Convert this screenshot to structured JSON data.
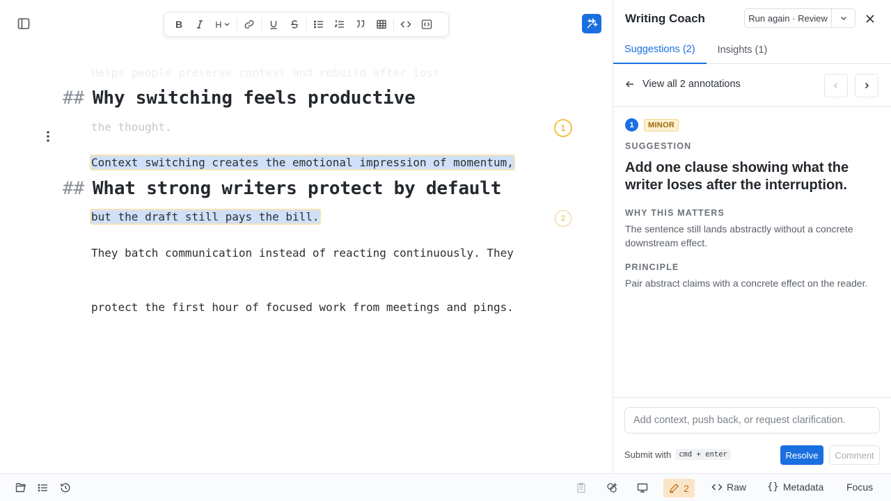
{
  "editor": {
    "faded_lines": [
      "Helps people preserve context and rebuild after lost",
      "the thought."
    ],
    "sections": [
      {
        "hash": "##",
        "heading": "Why switching feels productive",
        "lines": [
          "Context switching creates the emotional impression of momentum,",
          "but the draft still pays the bill."
        ],
        "annotation": "1"
      },
      {
        "hash": "##",
        "heading": "What strong writers protect by default",
        "lines": [
          "They batch communication instead of reacting continuously. They",
          "protect the first hour of focused work from meetings and pings."
        ],
        "annotation": "2"
      }
    ],
    "toolbar": {
      "bold": "B",
      "heading": "H"
    }
  },
  "coach": {
    "title": "Writing Coach",
    "run_label": "Run again · Review",
    "tabs": [
      {
        "label": "Suggestions (2)"
      },
      {
        "label": "Insights (1)"
      }
    ],
    "view_all": "View all 2 annotations",
    "annotation": {
      "number": "1",
      "severity": "MINOR",
      "label": "SUGGESTION",
      "text": "Add one clause showing what the writer loses after the interruption.",
      "why_label": "WHY THIS MATTERS",
      "why_text": "The sentence still lands abstractly without a concrete downstream effect.",
      "principle_label": "PRINCIPLE",
      "principle_text": "Pair abstract claims with a concrete effect on the reader."
    },
    "reply_placeholder": "Add context, push back, or request clarification.",
    "submit_hint": "Submit with",
    "shortcut": "cmd + enter",
    "resolve_label": "Resolve",
    "comment_label": "Comment"
  },
  "statusbar": {
    "annotation_count": "2",
    "raw_label": "Raw",
    "metadata_label": "Metadata",
    "focus_label": "Focus"
  },
  "colors": {
    "accent": "#1a6fe0",
    "highlight": "#cfe0f8",
    "minor_badge": "#fdf1cf",
    "annotation_ring": "#f0c24a"
  }
}
